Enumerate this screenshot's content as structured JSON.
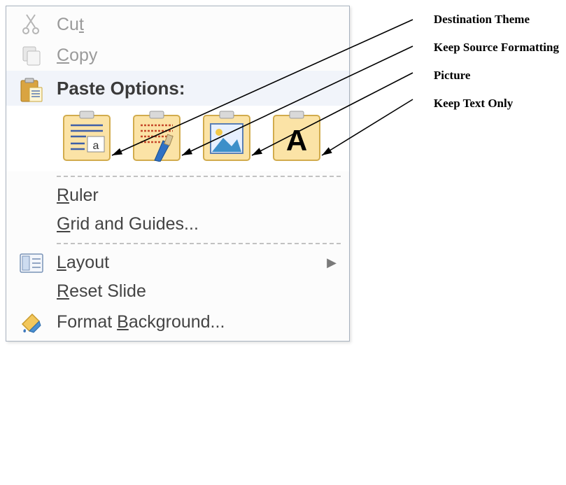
{
  "menu": {
    "cut_label": "Cut",
    "cut_underline": "t",
    "copy_label": "Copy",
    "copy_underline": "C",
    "paste_header": "Paste Options:",
    "paste_options": {
      "destination_theme": "Use Destination Theme",
      "keep_source": "Keep Source Formatting",
      "picture": "Picture",
      "text_only": "Keep Text Only"
    },
    "ruler_label": "Ruler",
    "ruler_underline": "R",
    "grid_label": "Grid and Guides...",
    "grid_underline": "G",
    "layout_label": "Layout",
    "layout_underline": "L",
    "reset_label": "Reset Slide",
    "reset_underline": "R",
    "format_bg_label": "Format Background...",
    "format_bg_underline": "B"
  },
  "annotations": {
    "a1": "Destination Theme",
    "a2": "Keep Source Formatting",
    "a3": "Picture",
    "a4": "Keep Text Only"
  }
}
